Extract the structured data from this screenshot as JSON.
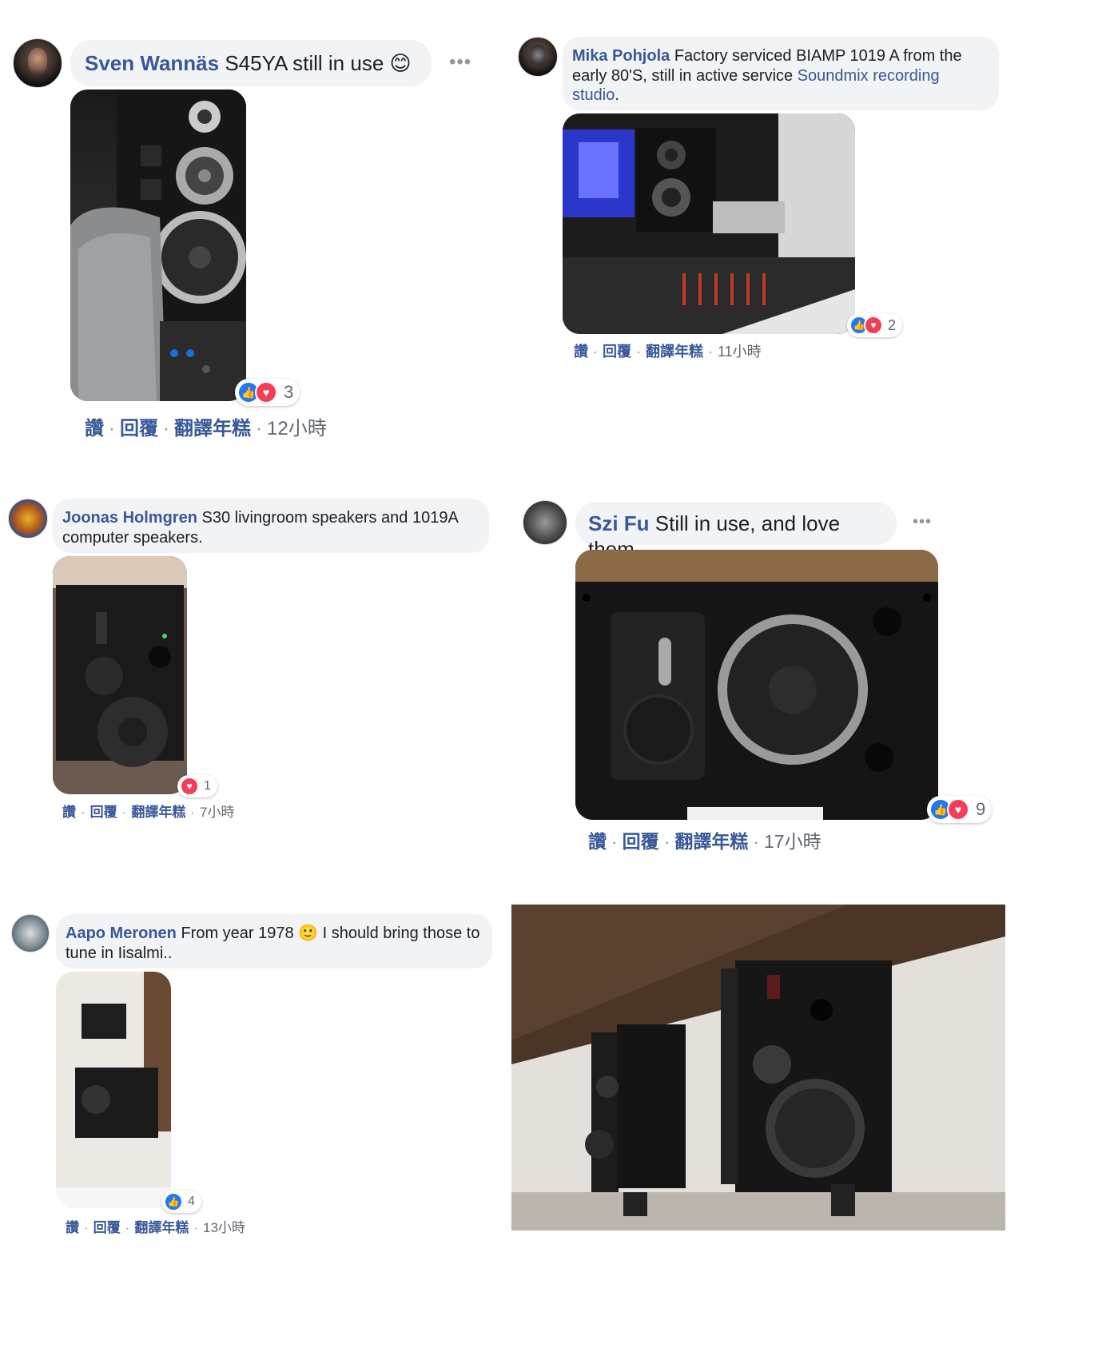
{
  "comments": [
    {
      "name": "Sven Wannäs",
      "text": "S45YA still in use",
      "emoji": "😊",
      "reactions": {
        "count": "3",
        "types": [
          "like-icon",
          "love-icon"
        ]
      },
      "actions": {
        "like": "讚",
        "reply": "回覆",
        "translate": "翻譯年糕",
        "time": "12小時"
      }
    },
    {
      "name": "Mika Pohjola",
      "text_before_link": "Factory serviced BIAMP 1019 A from the early 80'S, still in active service",
      "link": "Soundmix recording studio",
      "text_after_link": ".",
      "reactions": {
        "count": "2",
        "types": [
          "like-icon",
          "love-icon"
        ]
      },
      "actions": {
        "like": "讚",
        "reply": "回覆",
        "translate": "翻譯年糕",
        "time": "11小時"
      }
    },
    {
      "name": "Joonas Holmgren",
      "text": "S30 livingroom speakers and 1019A computer speakers.",
      "reactions": {
        "count": "1",
        "types": [
          "love-icon"
        ]
      },
      "actions": {
        "like": "讚",
        "reply": "回覆",
        "translate": "翻譯年糕",
        "time": "7小時"
      }
    },
    {
      "name": "Szi Fu",
      "text": "Still in use, and love them.",
      "reactions": {
        "count": "9",
        "types": [
          "like-icon",
          "love-icon"
        ]
      },
      "actions": {
        "like": "讚",
        "reply": "回覆",
        "translate": "翻譯年糕",
        "time": "17小時"
      }
    },
    {
      "name": "Aapo Meronen",
      "text_before_emoji": "From year 1978",
      "emoji": "🙂",
      "text_after_emoji": "I should bring those to tune in Iisalmi..",
      "reactions": {
        "count": "4",
        "types": [
          "like-icon"
        ]
      },
      "actions": {
        "like": "讚",
        "reply": "回覆",
        "translate": "翻譯年糕",
        "time": "13小時"
      }
    }
  ],
  "ui": {
    "more_glyph": "•••"
  },
  "colors": {
    "name": "#385898",
    "bubble": "#f2f3f5",
    "like": "#2078f4",
    "love": "#f33e58"
  }
}
